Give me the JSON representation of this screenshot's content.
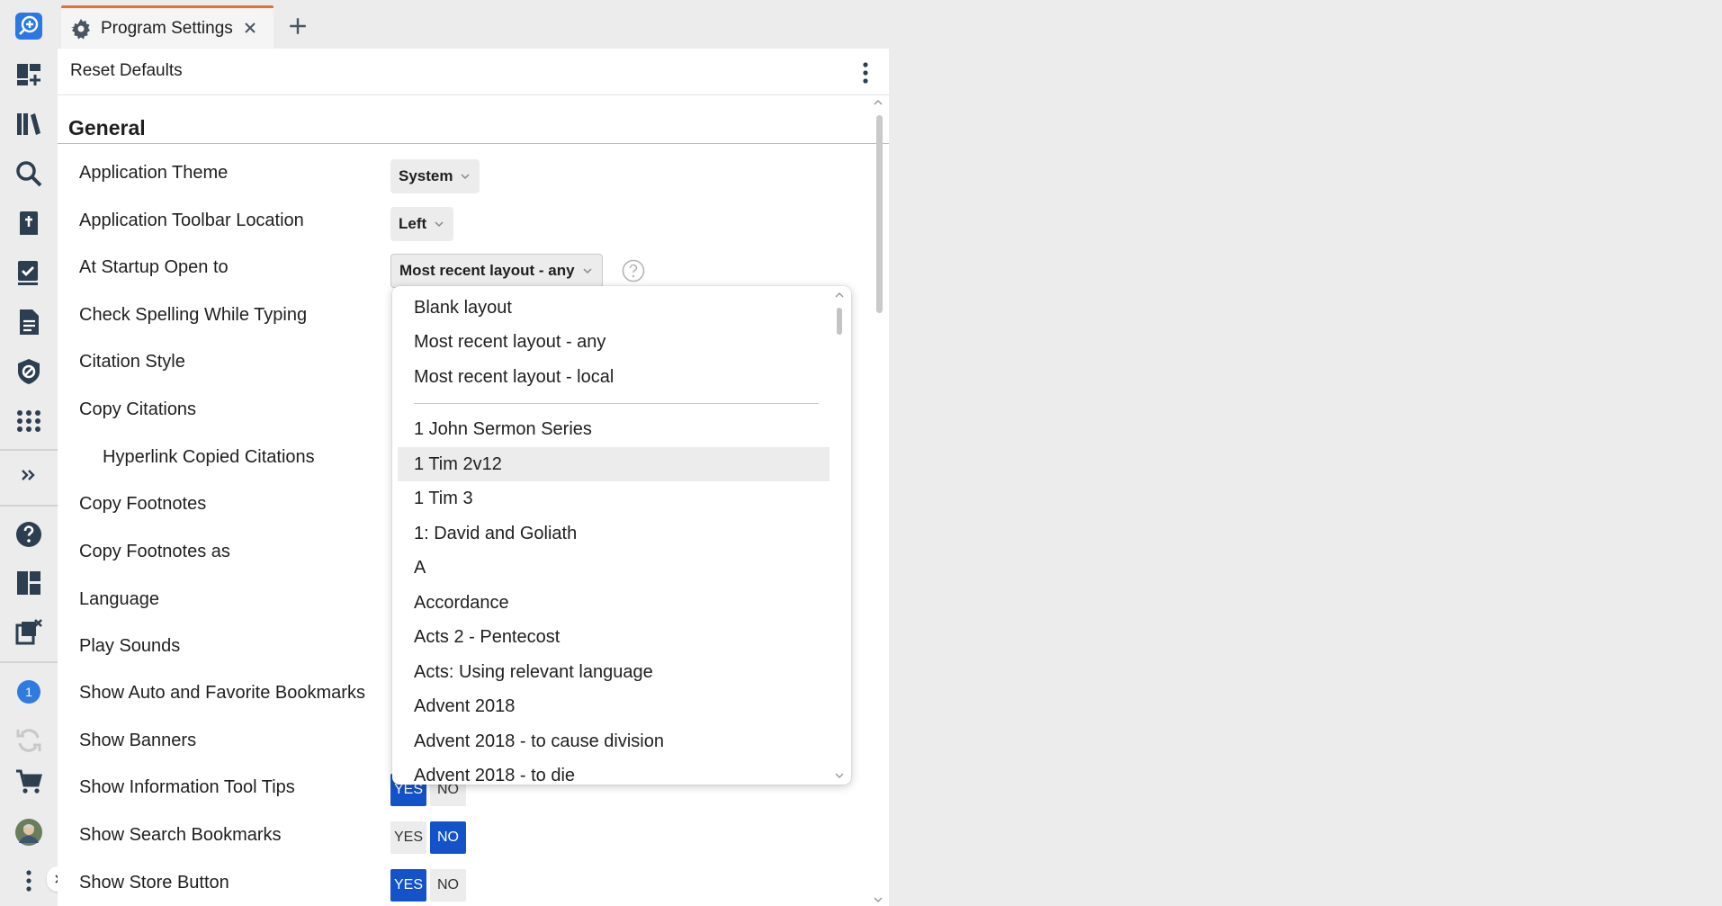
{
  "colors": {
    "accent": "#1352c9",
    "tab_accent": "#e8722c",
    "toolbar_bg": "#ececec",
    "badge": "#2f7be0"
  },
  "toolbar": {
    "items": [
      {
        "icon": "logos-home-icon"
      },
      {
        "icon": "add-panel-icon"
      },
      {
        "icon": "library-icon"
      },
      {
        "icon": "search-icon"
      },
      {
        "icon": "bible-icon"
      },
      {
        "icon": "checklist-icon"
      },
      {
        "icon": "document-icon"
      },
      {
        "icon": "shield-icon"
      },
      {
        "icon": "apps-grid-icon"
      },
      {
        "icon": "expand-chevrons-icon"
      },
      {
        "icon": "help-icon"
      },
      {
        "icon": "layouts-icon"
      },
      {
        "icon": "close-panels-icon"
      },
      {
        "icon": "notification-badge-icon"
      },
      {
        "icon": "sync-icon"
      },
      {
        "icon": "cart-icon"
      },
      {
        "icon": "user-avatar"
      },
      {
        "icon": "more-vertical-icon"
      }
    ],
    "badge_count": "1"
  },
  "tab": {
    "title": "Program Settings",
    "new_tab_label": "+"
  },
  "panel": {
    "reset_label": "Reset Defaults"
  },
  "section": {
    "title": "General"
  },
  "settings": [
    {
      "label": "Application Theme",
      "control": "select",
      "value": "System"
    },
    {
      "label": "Application Toolbar Location",
      "control": "select",
      "value": "Left"
    },
    {
      "label": "At Startup Open to",
      "control": "select",
      "value": "Most recent layout - any"
    },
    {
      "label": "Check Spelling While Typing"
    },
    {
      "label": "Citation Style"
    },
    {
      "label": "Copy Citations"
    },
    {
      "label": "Hyperlink Copied Citations"
    },
    {
      "label": "Copy Footnotes"
    },
    {
      "label": "Copy Footnotes as"
    },
    {
      "label": "Language"
    },
    {
      "label": "Play Sounds"
    },
    {
      "label": "Show Auto and Favorite Bookmarks"
    },
    {
      "label": "Show Banners"
    },
    {
      "label": "Show Information Tool Tips",
      "control": "toggle",
      "value": "YES"
    },
    {
      "label": "Show Search Bookmarks",
      "control": "toggle",
      "value": "NO"
    },
    {
      "label": "Show Store Button",
      "control": "toggle",
      "value": "YES"
    }
  ],
  "toggle_labels": {
    "yes": "YES",
    "no": "NO"
  },
  "dropdown": {
    "items": [
      "Blank layout",
      "Most recent layout - any",
      "Most recent layout - local",
      "1 John Sermon Series",
      "1 Tim 2v12",
      "1 Tim 3",
      "1: David and Goliath",
      "A",
      "Accordance",
      "Acts 2 - Pentecost",
      "Acts: Using relevant language",
      "Advent 2018",
      "Advent 2018 - to cause division",
      "Advent 2018 - to die"
    ],
    "hovered": "1 Tim 2v12"
  }
}
